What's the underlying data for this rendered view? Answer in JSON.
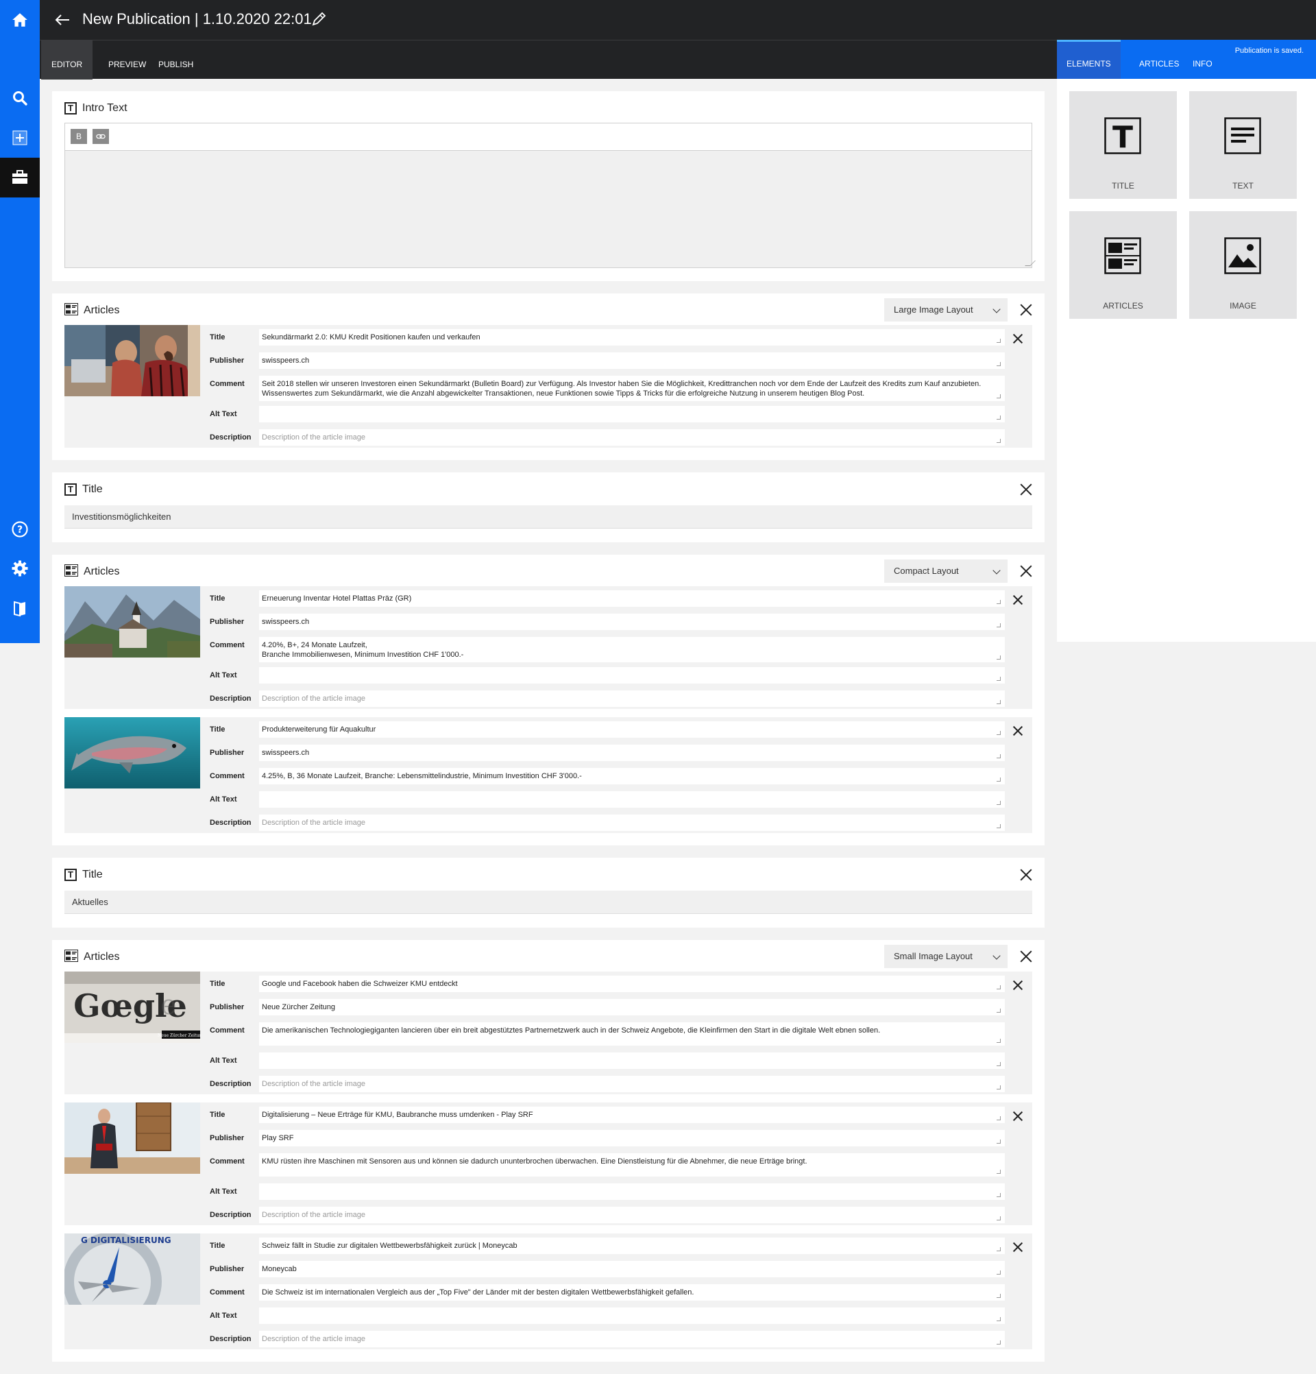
{
  "header": {
    "title": "New Publication | 1.10.2020 22:01"
  },
  "tabs": [
    {
      "label": "EDITOR",
      "active": true
    },
    {
      "label": "PREVIEW",
      "active": false
    },
    {
      "label": "PUBLISH",
      "active": false
    }
  ],
  "right_tabs": [
    {
      "label": "ELEMENTS",
      "active": true
    },
    {
      "label": "ARTICLES",
      "active": false
    },
    {
      "label": "INFO",
      "active": false
    }
  ],
  "status": "Publication is saved.",
  "elements": [
    {
      "label": "TITLE",
      "icon": "title-icon"
    },
    {
      "label": "TEXT",
      "icon": "text-icon"
    },
    {
      "label": "ARTICLES",
      "icon": "articles-icon"
    },
    {
      "label": "IMAGE",
      "icon": "image-icon"
    }
  ],
  "field_labels": {
    "title": "Title",
    "publisher": "Publisher",
    "comment": "Comment",
    "alt": "Alt Text",
    "description": "Description"
  },
  "description_placeholder": "Description of the article image",
  "intro": {
    "label": "Intro Text",
    "bold": "B",
    "link_icon": "link-icon"
  },
  "blocks": [
    {
      "type": "articles",
      "label": "Articles",
      "layout": "Large Image Layout",
      "articles": [
        {
          "title": "Sekundärmarkt 2.0: KMU Kredit Positionen kaufen und verkaufen",
          "publisher": "swisspeers.ch",
          "comment": "Seit 2018 stellen wir unseren Investoren einen Sekundärmarkt (Bulletin Board) zur Verfügung. Als Investor haben Sie die Möglichkeit, Kredittranchen noch vor dem Ende der Laufzeit des Kredits zum Kauf anzubieten. Wissenswertes zum Sekundärmarkt, wie die Anzahl abgewickelter Transaktionen, neue Funktionen sowie Tipps & Tricks für die erfolgreiche Nutzung in unserem heutigen Blog Post.",
          "alt": "",
          "thumb": "office"
        }
      ]
    },
    {
      "type": "title",
      "label": "Title",
      "value": "Investitionsmöglichkeiten"
    },
    {
      "type": "articles",
      "label": "Articles",
      "layout": "Compact Layout",
      "articles": [
        {
          "title": "Erneuerung Inventar Hotel Plattas Präz (GR)",
          "publisher": "swisspeers.ch",
          "comment": "4.20%, B+, 24 Monate Laufzeit,\nBranche Immobilienwesen, Minimum Investition CHF 1'000.-",
          "alt": "",
          "thumb": "mountain"
        },
        {
          "title": "Produkterweiterung für Aquakultur",
          "publisher": "swisspeers.ch",
          "comment": "4.25%, B, 36 Monate Laufzeit, Branche: Lebensmittelindustrie, Minimum Investition CHF 3'000.-",
          "alt": "",
          "thumb": "fish"
        }
      ]
    },
    {
      "type": "title",
      "label": "Title",
      "value": "Aktuelles"
    },
    {
      "type": "articles",
      "label": "Articles",
      "layout": "Small Image Layout",
      "articles": [
        {
          "title": "Google und Facebook haben die Schweizer KMU entdeckt",
          "publisher": "Neue Zürcher Zeitung",
          "comment": "Die amerikanischen Technologiegiganten lancieren über ein breit abgestütztes Partnernetzwerk auch in der Schweiz Angebote, die Kleinfirmen den Start in die digitale Welt ebnen sollen.",
          "alt": "",
          "thumb": "google"
        },
        {
          "title": "Digitalisierung – Neue Erträge für KMU, Baubranche muss umdenken - Play SRF",
          "publisher": "Play SRF",
          "comment": "KMU rüsten ihre Maschinen mit Sensoren aus und können sie dadurch ununterbrochen überwachen. Eine Dienstleistung für die Abnehmer, die neue Erträge bringt.",
          "alt": "",
          "thumb": "anchor"
        },
        {
          "title": "Schweiz fällt in Studie zur digitalen Wettbewerbsfähigkeit zurück | Moneycab",
          "publisher": "Moneycab",
          "comment": "Die Schweiz ist im internationalen Vergleich aus der „Top Five\" der Länder mit der besten digitalen Wettbewerbsfähigkeit gefallen.",
          "alt": "",
          "thumb": "compass"
        }
      ]
    }
  ]
}
